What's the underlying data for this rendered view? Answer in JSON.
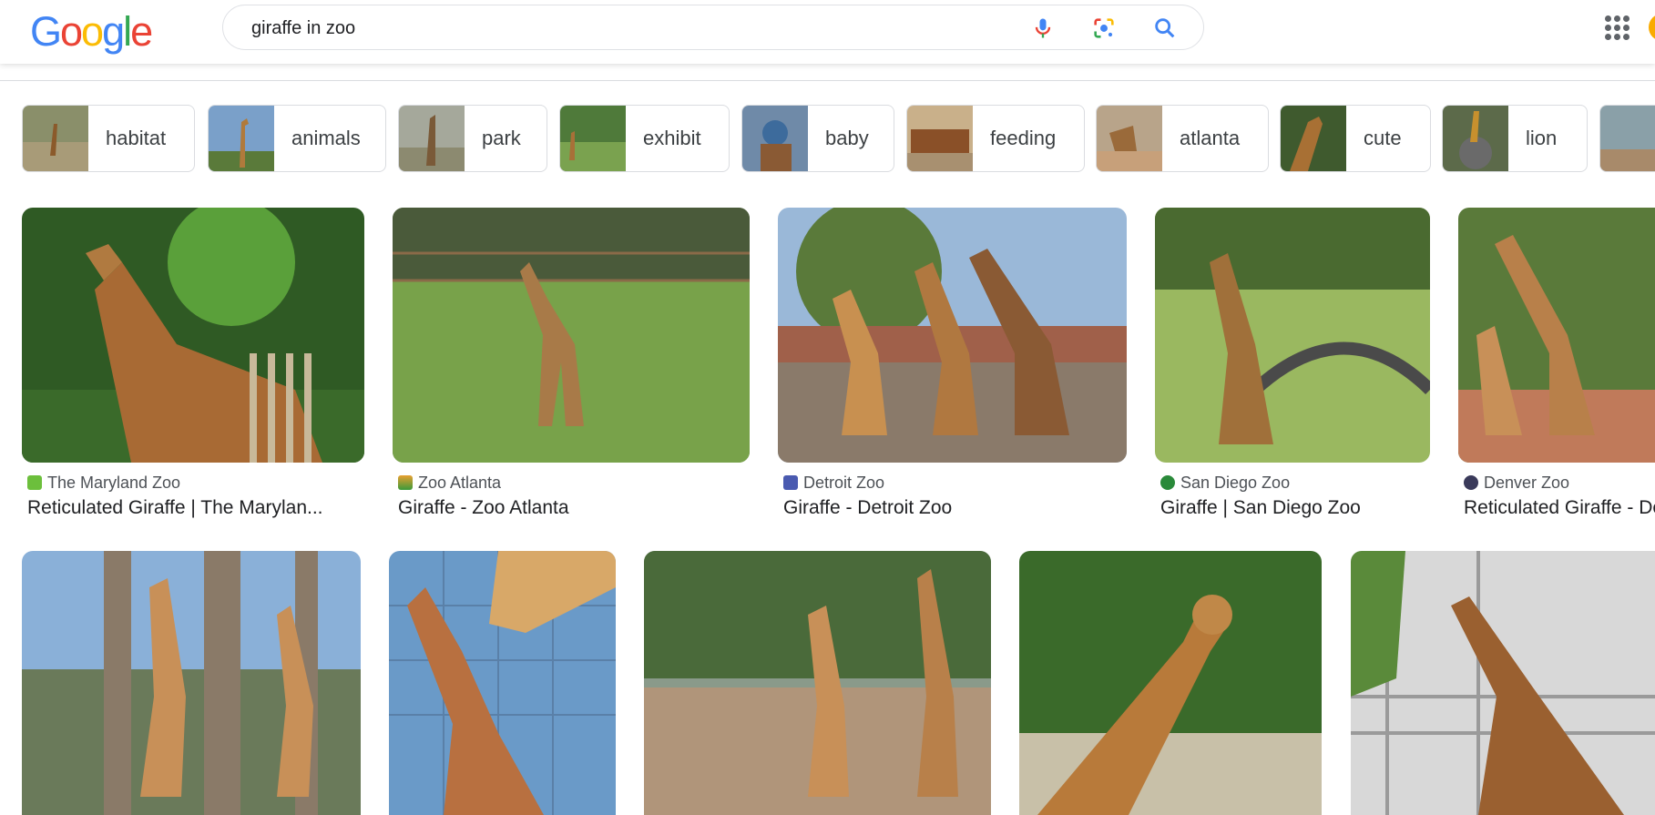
{
  "logo": {
    "text": "Google",
    "letters": [
      "G",
      "o",
      "o",
      "g",
      "l",
      "e"
    ],
    "colors": [
      "#4285f4",
      "#ea4335",
      "#fbbc05",
      "#4285f4",
      "#34a853",
      "#ea4335"
    ]
  },
  "search": {
    "query": "giraffe in zoo"
  },
  "icons": {
    "mic": "microphone-icon",
    "lens": "camera-lens-icon",
    "search": "search-icon",
    "apps": "apps-grid-icon"
  },
  "chips": [
    {
      "label": "habitat"
    },
    {
      "label": "animals"
    },
    {
      "label": "park"
    },
    {
      "label": "exhibit"
    },
    {
      "label": "baby"
    },
    {
      "label": "feeding"
    },
    {
      "label": "atlanta"
    },
    {
      "label": "cute"
    },
    {
      "label": "lion"
    }
  ],
  "results": [
    {
      "source": "The Maryland Zoo",
      "title": "Reticulated Giraffe | The Marylan..."
    },
    {
      "source": "Zoo Atlanta",
      "title": "Giraffe - Zoo Atlanta"
    },
    {
      "source": "Detroit Zoo",
      "title": "Giraffe - Detroit Zoo"
    },
    {
      "source": "San Diego Zoo",
      "title": "Giraffe | San Diego Zoo"
    },
    {
      "source": "Denver Zoo",
      "title": "Reticulated Giraffe - Denver"
    }
  ],
  "colors": {
    "accent": "#1a73e8",
    "text": "#202124",
    "muted": "#4d5156"
  }
}
